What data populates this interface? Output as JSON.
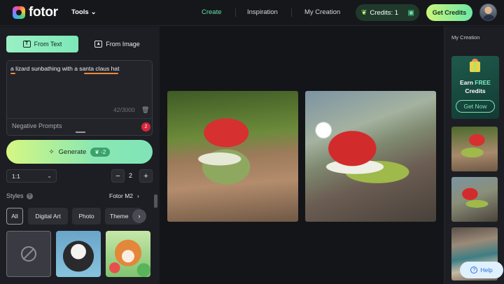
{
  "header": {
    "logo_text": "fotor",
    "tools_label": "Tools",
    "nav": [
      "Create",
      "Inspiration",
      "My Creation"
    ],
    "active_nav": "Create",
    "credits_label": "Credits: 1",
    "get_credits_label": "Get Credits"
  },
  "left_panel": {
    "tabs": [
      {
        "label": "From Text",
        "active": true
      },
      {
        "label": "From Image",
        "active": false
      }
    ],
    "prompt_value": "a lizard sunbathing with a santa claus hat",
    "char_counter": "42/3000",
    "negative_prompts_label": "Negative Prompts",
    "negative_badge": "2",
    "generate_label": "Generate",
    "generate_cost": "-2",
    "aspect_ratio": "1:1",
    "image_count": "2",
    "styles_label": "Styles",
    "model_label": "Fotor M2",
    "style_chips": [
      "All",
      "Digital Art",
      "Photo",
      "Theme"
    ],
    "active_chip": "All"
  },
  "right_panel": {
    "title": "My Creation",
    "earn_label": "Earn",
    "earn_free": "FREE",
    "earn_credits": "Credits",
    "get_now_label": "Get Now"
  },
  "help_label": "Help",
  "colors": {
    "accent_green": "#62e2a3",
    "generate_gradient_start": "#d6f782",
    "generate_gradient_end": "#7fe4b8",
    "badge_red": "#d8263b",
    "background": "#141519",
    "panel": "#1d1e23"
  },
  "icons": {
    "from_text": "text-box-icon",
    "from_image": "image-icon",
    "trash": "trash-icon",
    "generate": "magic-wand-icon",
    "credits": "leaf-icon",
    "gift": "gift-icon",
    "help": "question-circle-icon"
  }
}
